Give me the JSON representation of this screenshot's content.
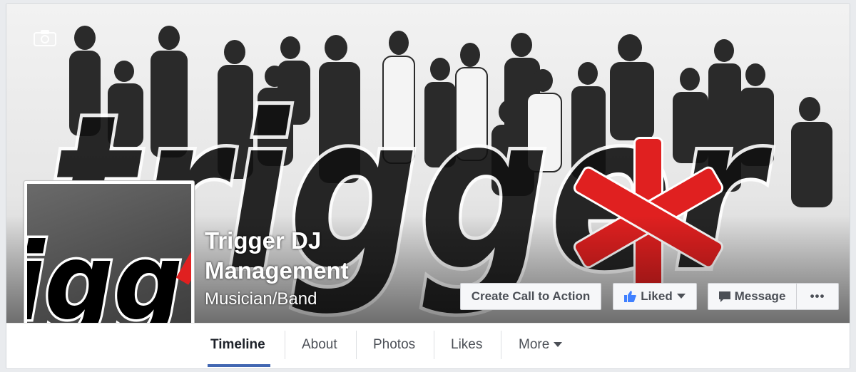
{
  "page": {
    "name": "Trigger DJ Management",
    "category": "Musician/Band"
  },
  "cover": {
    "brand_text": "trigger",
    "camera_icon": "camera-icon"
  },
  "avatar": {
    "brand_text": "igg",
    "camera_icon": "camera-icon"
  },
  "actions": {
    "cta_label": "Create Call to Action",
    "liked_label": "Liked",
    "message_label": "Message",
    "more_label": "•••"
  },
  "tabs": [
    {
      "label": "Timeline",
      "active": true
    },
    {
      "label": "About"
    },
    {
      "label": "Photos"
    },
    {
      "label": "Likes"
    },
    {
      "label": "More"
    }
  ],
  "colors": {
    "accent": "#4267b2",
    "brand_red": "#e02020",
    "like_blue": "#4080ff"
  }
}
